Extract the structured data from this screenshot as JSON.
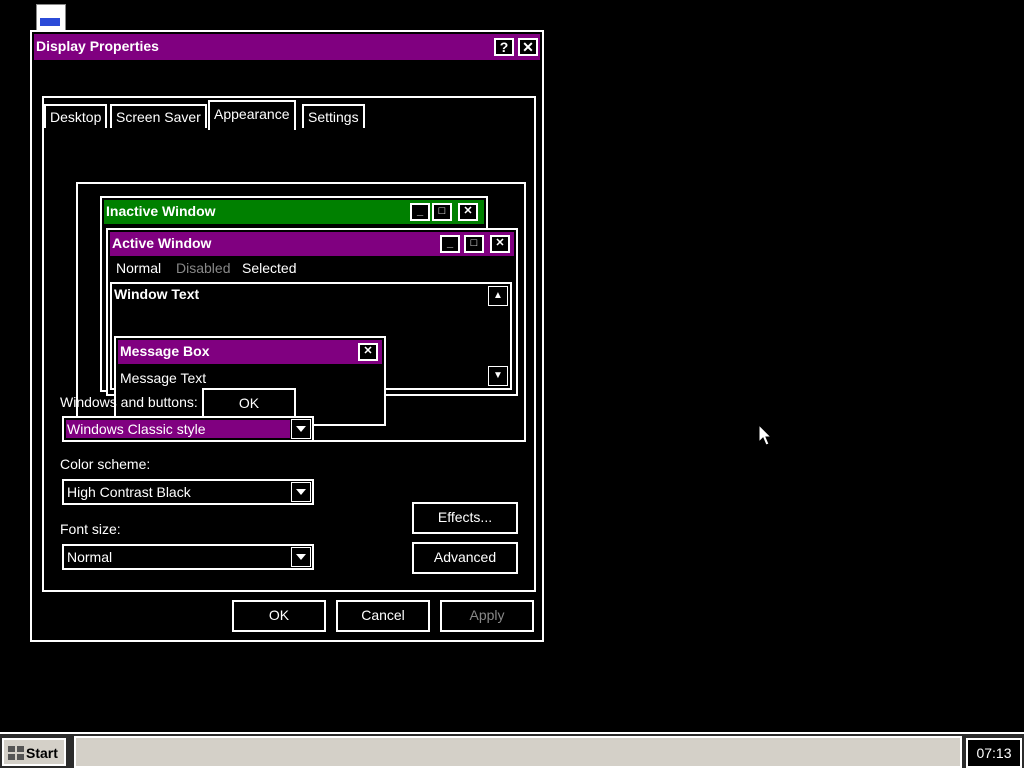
{
  "desktop": {
    "icon_name": "document-icon"
  },
  "dialog": {
    "title": "Display Properties",
    "help_glyph": "?",
    "close_glyph": "✕",
    "tabs": [
      {
        "label": "Desktop",
        "active": false
      },
      {
        "label": "Screen Saver",
        "active": false
      },
      {
        "label": "Appearance",
        "active": true
      },
      {
        "label": "Settings",
        "active": false
      }
    ],
    "preview": {
      "inactive_title": "Inactive Window",
      "active_title": "Active Window",
      "menu": [
        "Normal",
        "Disabled",
        "Selected"
      ],
      "window_text": "Window Text",
      "message_box_title": "Message Box",
      "message_text": "Message Text",
      "ok_label": "OK"
    },
    "windows_buttons_label": "Windows and buttons:",
    "windows_buttons_value": "Windows Classic style",
    "color_scheme_label": "Color scheme:",
    "color_scheme_value": "High Contrast Black",
    "font_size_label": "Font size:",
    "font_size_value": "Normal",
    "effects_label": "Effects...",
    "advanced_label": "Advanced",
    "ok_label": "OK",
    "cancel_label": "Cancel",
    "apply_label": "Apply"
  },
  "taskbar": {
    "start_label": "Start",
    "clock": "07:13"
  },
  "colors": {
    "active_title": "#800080",
    "inactive_title": "#008000",
    "taskbar_area": "#d4d0c8"
  }
}
